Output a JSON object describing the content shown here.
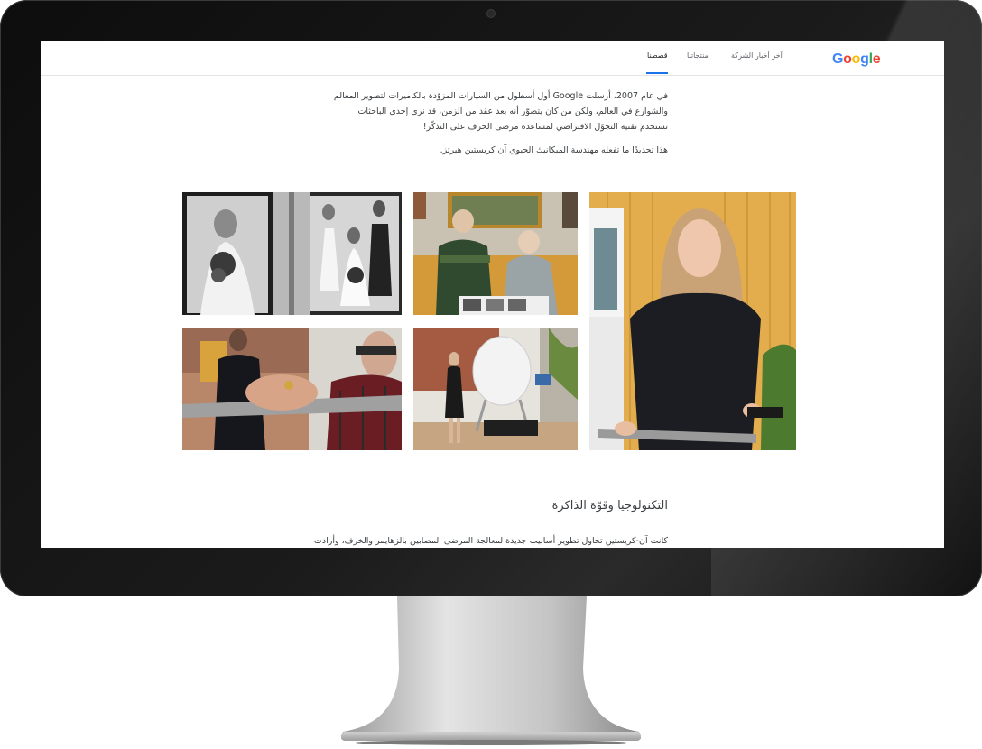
{
  "header": {
    "logo": "Google",
    "nav": [
      {
        "label": "آخر أخبار الشركة"
      },
      {
        "label": "منتجاتنا"
      },
      {
        "label": "قصصنا",
        "active": true
      }
    ]
  },
  "story": {
    "intro": "في عام 2007، أرسلت Google أول أسطول من السيارات المزوّدة بالكاميرات لتصوير المعالم والشوارع في العالم، ولكن من كان يتصوّر أنه بعد عقد من الزمن، قد نرى إحدى الباحثات تستخدم تقنية التجوّل الافتراضي لمساعدة مرضى الخرف على التذكّر!",
    "lead": "هذا تحديدًا ما تفعله مهندسة الميكانيك الحيوي آن كريستين هيرتز.",
    "section_heading": "التكنولوجيا وقوّة الذاكرة",
    "section_text": "كانت آن-كريستين تحاول تطوير أساليب جديدة لمعالجة المرضى المصابين بالزهايمر والخرف، وأرادت"
  },
  "photos": [
    {
      "name": "wedding-photos-image"
    },
    {
      "name": "elderly-couple-image"
    },
    {
      "name": "researcher-portrait-image"
    },
    {
      "name": "walker-hands-image"
    },
    {
      "name": "vr-lab-image"
    }
  ],
  "colors": {
    "accent": "#1a73e8",
    "text": "#3c4043",
    "google_blue": "#4285F4",
    "google_red": "#EA4335",
    "google_yellow": "#FBBC05",
    "google_green": "#34A853"
  }
}
